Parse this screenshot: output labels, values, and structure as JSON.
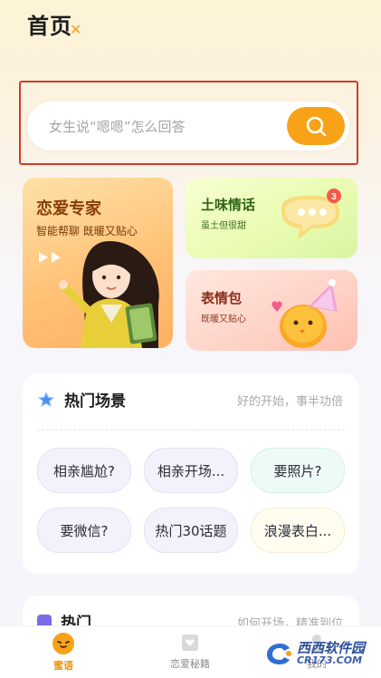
{
  "header": {
    "title": "首页"
  },
  "search": {
    "placeholder": "女生说“嗯嗯”怎么回答"
  },
  "cards": {
    "expert": {
      "title": "恋爱专家",
      "subtitle": "智能帮聊 既暖又贴心"
    },
    "sweet_talk": {
      "title": "土味情话",
      "subtitle": "虽土但很甜",
      "badge": "3"
    },
    "emoji": {
      "title": "表情包",
      "subtitle": "既暖又贴心"
    }
  },
  "scenes": {
    "title": "热门场景",
    "hint": "好的开始，事半功倍",
    "chips": [
      "相亲尴尬?",
      "相亲开场...",
      "要照片?",
      "要微信?",
      "热门30话题",
      "浪漫表白..."
    ]
  },
  "hot": {
    "title": "热门",
    "hint": "如何开场，精准到位"
  },
  "tabbar": {
    "items": [
      {
        "label": "蜜语",
        "active": true
      },
      {
        "label": "恋爱秘籍",
        "active": false
      },
      {
        "label": "我的",
        "active": false
      }
    ]
  },
  "watermark": {
    "text": "西西软件园",
    "sub": "CR173.COM"
  },
  "colors": {
    "accent": "#f7a217",
    "highlight_border": "#d23a2c"
  }
}
